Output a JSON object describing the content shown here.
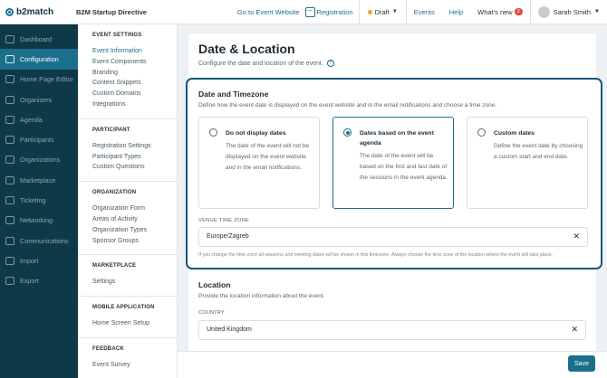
{
  "topbar": {
    "logo": "b2match",
    "event_name": "B2M Startup Directive",
    "go_to_event": "Go to Event Website",
    "registration": "Registration",
    "status": "Draft",
    "events": "Events",
    "help": "Help",
    "whats_new": "What's new",
    "whats_new_count": "2",
    "user": "Sarah Smith"
  },
  "sidebar": {
    "items": [
      {
        "label": "Dashboard",
        "icon": "dashboard-icon"
      },
      {
        "label": "Configuration",
        "icon": "gear-icon"
      },
      {
        "label": "Home Page Editor",
        "icon": "home-icon"
      },
      {
        "label": "Organizers",
        "icon": "organizers-icon"
      },
      {
        "label": "Agenda",
        "icon": "agenda-icon"
      },
      {
        "label": "Participants",
        "icon": "participants-icon"
      },
      {
        "label": "Organizations",
        "icon": "organizations-icon"
      },
      {
        "label": "Marketplace",
        "icon": "marketplace-icon"
      },
      {
        "label": "Ticketing",
        "icon": "ticket-icon"
      },
      {
        "label": "Networking",
        "icon": "networking-icon"
      },
      {
        "label": "Communications",
        "icon": "communications-icon"
      },
      {
        "label": "Import",
        "icon": "import-icon"
      },
      {
        "label": "Export",
        "icon": "export-icon"
      }
    ]
  },
  "subnav": {
    "event_settings": {
      "heading": "EVENT SETTINGS",
      "items": [
        "Event Information",
        "Event Components",
        "Branding",
        "Content Snippets",
        "Custom Domains",
        "Integrations"
      ]
    },
    "participant": {
      "heading": "PARTICIPANT",
      "items": [
        "Registration Settings",
        "Participant Types",
        "Custom Questions"
      ]
    },
    "organization": {
      "heading": "ORGANIZATION",
      "items": [
        "Organization Form",
        "Areas of Activity",
        "Organization Types",
        "Sponsor Groups"
      ]
    },
    "marketplace": {
      "heading": "MARKETPLACE",
      "items": [
        "Settings"
      ]
    },
    "mobile": {
      "heading": "MOBILE APPLICATION",
      "items": [
        "Home Screen Setup"
      ]
    },
    "feedback": {
      "heading": "FEEDBACK",
      "items": [
        "Event Survey"
      ]
    }
  },
  "main": {
    "title": "Date & Location",
    "description": "Configure the date and location of the event.",
    "date_section": {
      "title": "Date and Timezone",
      "description": "Define how the event date is displayed on the event website and in the email notifications and choose a time zone.",
      "options": [
        {
          "title": "Do not display dates",
          "description": "The date of the event will not be displayed on the event website and in the email notifications.",
          "selected": false
        },
        {
          "title": "Dates based on the event agenda",
          "description": "The date of the event will be based on the first and last date of the sessions in the event agenda.",
          "selected": true
        },
        {
          "title": "Custom dates",
          "description": "Define the event date by choosing a custom start and end date.",
          "selected": false
        }
      ],
      "timezone_label": "VENUE TIME ZONE",
      "timezone_value": "Europe/Zagreb",
      "timezone_hint": "If you change the time zone all sessions and meeting dates will be shown in this timezone. Always choose the time zone of the location where the event will take place."
    },
    "location_section": {
      "title": "Location",
      "description": "Provide the location information about the event.",
      "country_label": "COUNTRY",
      "country_value": "United Kingdom"
    },
    "save": "Save"
  }
}
